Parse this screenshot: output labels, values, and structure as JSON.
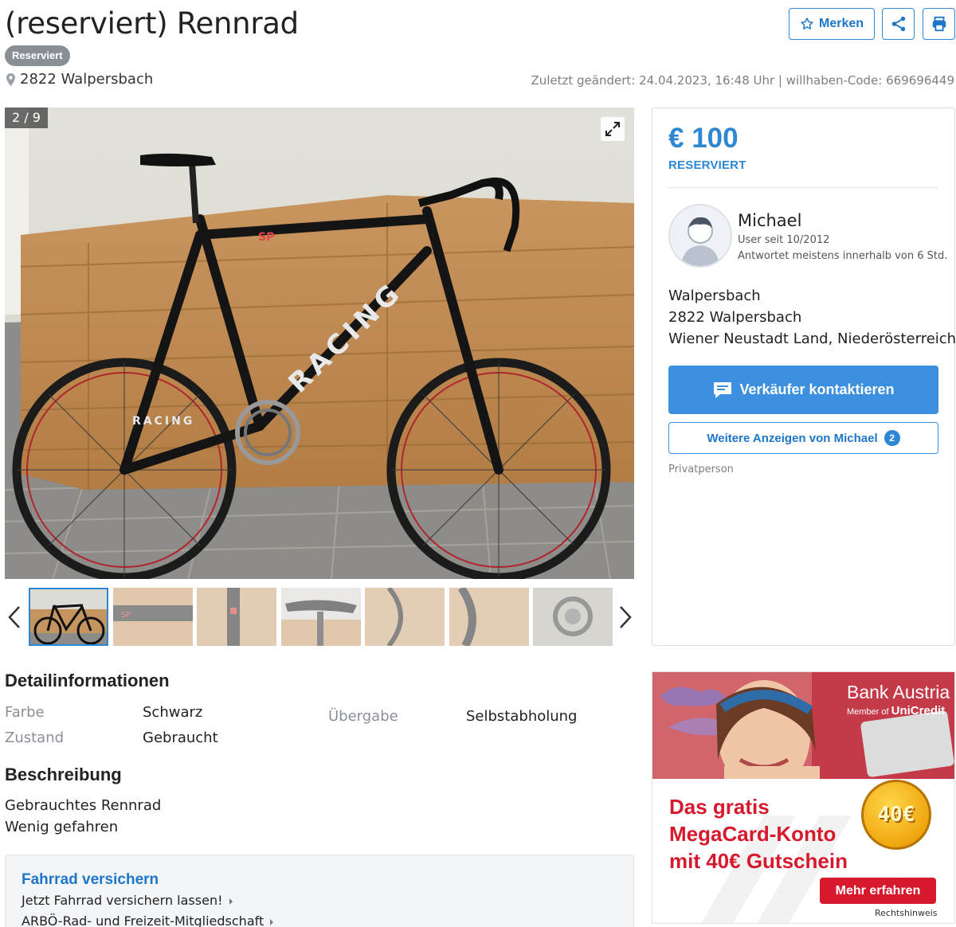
{
  "header": {
    "title": "(reserviert) Rennrad",
    "badge": "Reserviert",
    "location": "2822 Walpersbach",
    "meta": "Zuletzt geändert: 24.04.2023, 16:48 Uhr | willhaben-Code: 669696449",
    "save_label": "Merken",
    "share_icon": "share-icon",
    "print_icon": "print-icon"
  },
  "gallery": {
    "counter": "2 / 9",
    "thumbnail_count": 7,
    "active_thumbnail": 1
  },
  "sidebar": {
    "price": "€ 100",
    "price_status": "RESERVIERT",
    "seller": {
      "name": "Michael",
      "since": "User seit 10/2012",
      "response": "Antwortet meistens innerhalb von 6 Std."
    },
    "address": [
      "Walpersbach",
      "2822 Walpersbach",
      "Wiener Neustadt Land, Niederösterreich"
    ],
    "contact_label": "Verkäufer kontaktieren",
    "more_label": "Weitere Anzeigen von Michael",
    "more_count": "2",
    "seller_type": "Privatperson"
  },
  "details": {
    "title": "Detailinformationen",
    "rows": [
      {
        "label": "Farbe",
        "value": "Schwarz"
      },
      {
        "label": "Zustand",
        "value": "Gebraucht"
      },
      {
        "label": "Übergabe",
        "value": "Selbstabholung"
      }
    ]
  },
  "description": {
    "title": "Beschreibung",
    "lines": [
      "Gebrauchtes Rennrad",
      "Wenig gefahren"
    ]
  },
  "insurance": {
    "title": "Fahrrad versichern",
    "links": [
      "Jetzt Fahrrad versichern lassen!",
      "ARBÖ-Rad- und Freizeit-Mitgliedschaft"
    ]
  },
  "ad": {
    "brand": "Bank Austria",
    "member_prefix": "Member of",
    "member_brand": "UniCredit",
    "headline": "Das gratis MegaCard-Konto mit 40€ Gutschein",
    "coin": "40€",
    "cta": "Mehr erfahren",
    "legal": "Rechtshinweis",
    "brand_color": "#d7192d"
  },
  "colors": {
    "accent": "#2d87d3",
    "badge_gray": "#8a8f96"
  }
}
